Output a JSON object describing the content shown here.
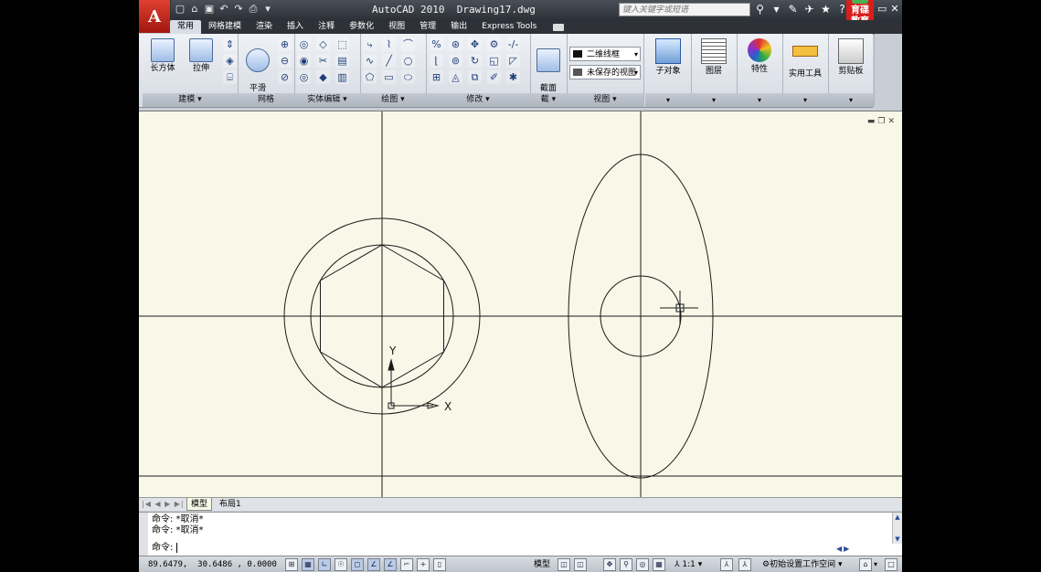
{
  "app": {
    "title": "AutoCAD 2010",
    "file": "Drawing17.dwg",
    "menu_logo": "A",
    "search_placeholder": "键入关键字或短语",
    "brand_logo": "育碟教育"
  },
  "quick_access": [
    "new-icon",
    "open-icon",
    "save-icon",
    "undo-icon",
    "redo-icon",
    "plot-icon",
    "dropdown-icon"
  ],
  "tabs": [
    {
      "label": "常用",
      "active": true
    },
    {
      "label": "网格建模"
    },
    {
      "label": "渲染"
    },
    {
      "label": "插入"
    },
    {
      "label": "注释"
    },
    {
      "label": "参数化"
    },
    {
      "label": "视图"
    },
    {
      "label": "管理"
    },
    {
      "label": "输出"
    },
    {
      "label": "Express Tools"
    }
  ],
  "ribbon": {
    "model_panel": {
      "label": "建模 ▾",
      "box": "长方体",
      "extrude": "拉伸"
    },
    "mesh_panel": {
      "label": "网格",
      "smooth": "平滑\n对象"
    },
    "solid_edit_panel": {
      "label": "实体编辑 ▾"
    },
    "draw_panel": {
      "label": "绘图 ▾"
    },
    "modify_panel": {
      "label": "修改 ▾"
    },
    "section_panel": {
      "label": "截 ▾",
      "section_plane": "截面\n平面"
    },
    "view_panel": {
      "label": "视图 ▾",
      "visual_style": "二维线框",
      "saved_view": "未保存的视图"
    },
    "sub_object": "子对象",
    "layers": "图层",
    "properties": "特性",
    "utilities": "实用工具",
    "clipboard": "剪贴板"
  },
  "drawing": {
    "ucs_x": "X",
    "ucs_y": "Y",
    "background": "#f8f8e8",
    "line_color": "#1a1a1a"
  },
  "layout_tabs": {
    "model": "模型",
    "layout1": "布局1"
  },
  "command": {
    "history": [
      "命令: *取消*",
      "命令: *取消*"
    ],
    "prompt": "命令:"
  },
  "status": {
    "coords": "89.6479,  30.6486 , 0.0000",
    "model": "模型",
    "scale": "1:1",
    "workspace": "初始设置工作空间"
  }
}
